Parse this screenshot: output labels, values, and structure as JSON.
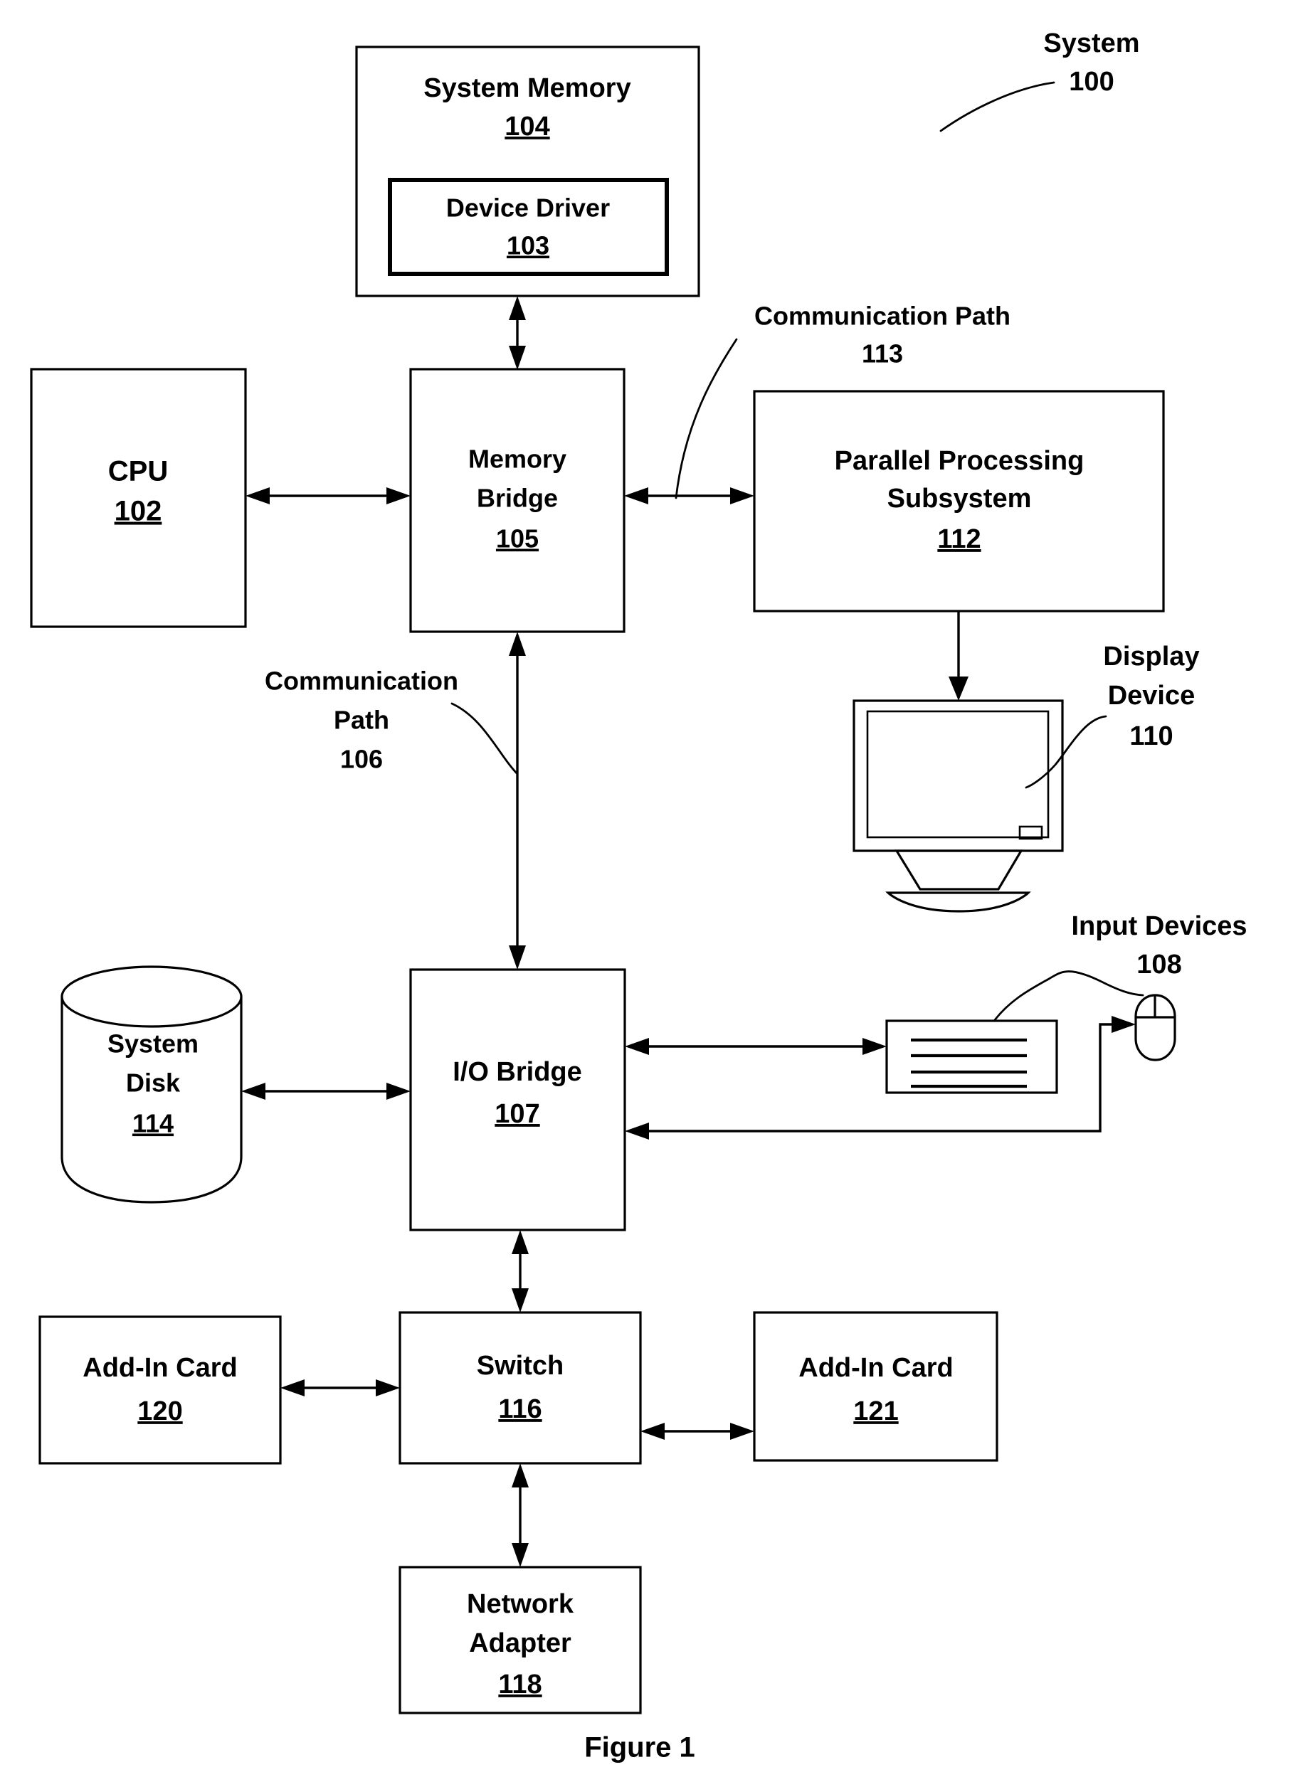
{
  "figure": {
    "caption": "Figure 1",
    "system_label": {
      "name": "System",
      "ref": "100"
    }
  },
  "blocks": {
    "system_memory": {
      "label": "System Memory",
      "ref": "104"
    },
    "device_driver": {
      "label": "Device Driver",
      "ref": "103"
    },
    "cpu": {
      "label": "CPU",
      "ref": "102"
    },
    "memory_bridge": {
      "label_line1": "Memory",
      "label_line2": "Bridge",
      "ref": "105"
    },
    "parallel_processing_subsystem": {
      "label_line1": "Parallel Processing",
      "label_line2": "Subsystem",
      "ref": "112"
    },
    "io_bridge": {
      "label": "I/O Bridge",
      "ref": "107"
    },
    "system_disk": {
      "label_line1": "System",
      "label_line2": "Disk",
      "ref": "114"
    },
    "switch": {
      "label": "Switch",
      "ref": "116"
    },
    "add_in_card_left": {
      "label": "Add-In Card",
      "ref": "120"
    },
    "add_in_card_right": {
      "label": "Add-In Card",
      "ref": "121"
    },
    "network_adapter": {
      "label_line1": "Network",
      "label_line2": "Adapter",
      "ref": "118"
    }
  },
  "callouts": {
    "communication_path_113": {
      "line1": "Communication Path",
      "line2": "113"
    },
    "communication_path_106": {
      "line1": "Communication",
      "line2": "Path",
      "line3": "106"
    },
    "display_device": {
      "line1": "Display",
      "line2": "Device",
      "line3": "110"
    },
    "input_devices": {
      "line1": "Input Devices",
      "line2": "108"
    }
  },
  "icons": {
    "display_device": "monitor-icon",
    "keyboard": "keyboard-icon",
    "mouse": "mouse-icon",
    "system_disk": "cylinder-disk-icon"
  },
  "colors": {
    "stroke": "#000000",
    "fill": "#ffffff",
    "background": "#ffffff"
  }
}
